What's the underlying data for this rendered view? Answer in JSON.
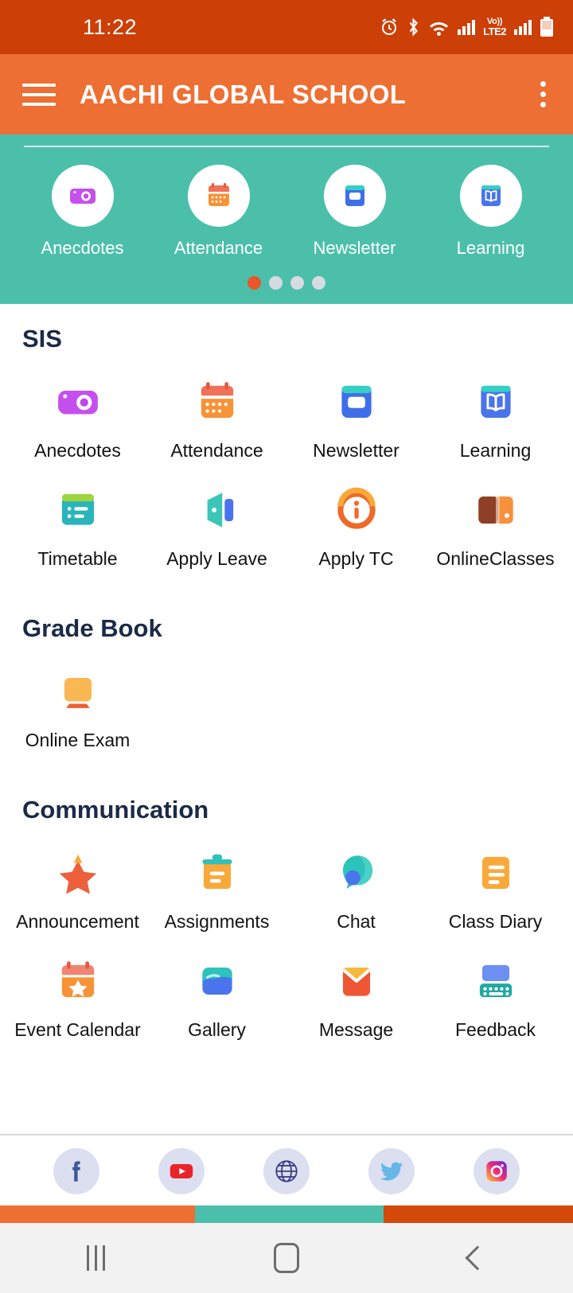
{
  "status_bar": {
    "time": "11:22",
    "icons": [
      "alarm-icon",
      "bluetooth-icon",
      "wifi-icon",
      "signal-icon",
      "volte-icon",
      "signal2-icon",
      "battery-icon"
    ],
    "volte_top": "Vo))",
    "volte_bottom": "LTE2",
    "background": "#cc3f06"
  },
  "app_bar": {
    "menu_icon": "hamburger-menu-icon",
    "title": "AACHI GLOBAL SCHOOL",
    "overflow_icon": "more-vertical-icon",
    "background": "#ed6f33"
  },
  "carousel": {
    "background": "#4cbfab",
    "items": [
      {
        "label": "Anecdotes",
        "icon": "camera-icon"
      },
      {
        "label": "Attendance",
        "icon": "calendar-icon"
      },
      {
        "label": "Newsletter",
        "icon": "newsletter-icon"
      },
      {
        "label": "Learning",
        "icon": "open-book-icon"
      }
    ],
    "dots": {
      "count": 4,
      "active_index": 0,
      "active_color": "#e8562a",
      "inactive_color": "#d5dbe0"
    }
  },
  "sections": [
    {
      "title": "SIS",
      "items": [
        {
          "label": "Anecdotes",
          "icon": "camera-icon"
        },
        {
          "label": "Attendance",
          "icon": "calendar-icon"
        },
        {
          "label": "Newsletter",
          "icon": "newsletter-icon"
        },
        {
          "label": "Learning",
          "icon": "open-book-icon"
        },
        {
          "label": "Timetable",
          "icon": "timetable-icon"
        },
        {
          "label": "Apply Leave",
          "icon": "door-exit-icon"
        },
        {
          "label": "Apply TC",
          "icon": "info-circle-icon"
        },
        {
          "label": "OnlineClasses",
          "icon": "online-classes-icon"
        }
      ]
    },
    {
      "title": "Grade Book",
      "items": [
        {
          "label": "Online Exam",
          "icon": "monitor-icon"
        }
      ]
    },
    {
      "title": "Communication",
      "items": [
        {
          "label": "Announcement",
          "icon": "star-icon"
        },
        {
          "label": "Assignments",
          "icon": "clipboard-icon"
        },
        {
          "label": "Chat",
          "icon": "chat-bubble-icon"
        },
        {
          "label": "Class Diary",
          "icon": "diary-icon"
        },
        {
          "label": "Event Calendar",
          "icon": "event-calendar-icon"
        },
        {
          "label": "Gallery",
          "icon": "gallery-icon"
        },
        {
          "label": "Message",
          "icon": "envelope-icon"
        },
        {
          "label": "Feedback",
          "icon": "feedback-keyboard-icon"
        }
      ]
    }
  ],
  "social_bar": {
    "items": [
      {
        "name": "facebook-icon",
        "label": "Facebook"
      },
      {
        "name": "youtube-icon",
        "label": "YouTube"
      },
      {
        "name": "website-icon",
        "label": "Website"
      },
      {
        "name": "twitter-icon",
        "label": "Twitter"
      },
      {
        "name": "instagram-icon",
        "label": "Instagram"
      }
    ]
  },
  "segment_bar": {
    "segments": [
      {
        "color": "#ed6f33",
        "width_pct": 34
      },
      {
        "color": "#4cbfab",
        "width_pct": 33
      },
      {
        "color": "#d44a0b",
        "width_pct": 33
      }
    ]
  },
  "nav_bar": {
    "recent_icon": "recent-apps-icon",
    "home_icon": "home-icon",
    "back_icon": "back-icon",
    "background": "#f2f2f2"
  }
}
